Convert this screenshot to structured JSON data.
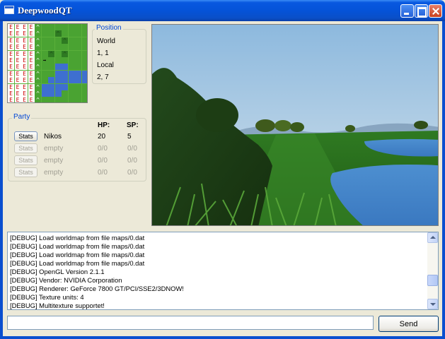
{
  "window": {
    "title": "DeepwoodQT",
    "minimize_label": "",
    "maximize_label": "",
    "close_label": ""
  },
  "minimap": {
    "border_char": "E",
    "mountain_char": "^",
    "player_char": "➡"
  },
  "position": {
    "group_title": "Position",
    "world_label": "World",
    "world_value": "1, 1",
    "local_label": "Local",
    "local_value": "2, 7"
  },
  "party": {
    "group_title": "Party",
    "hp_header": "HP:",
    "sp_header": "SP:",
    "stats_label": "Stats",
    "members": [
      {
        "name": "Nikos",
        "hp": "20",
        "sp": "5",
        "enabled": true
      },
      {
        "name": "empty",
        "hp": "0/0",
        "sp": "0/0",
        "enabled": false
      },
      {
        "name": "empty",
        "hp": "0/0",
        "sp": "0/0",
        "enabled": false
      },
      {
        "name": "empty",
        "hp": "0/0",
        "sp": "0/0",
        "enabled": false
      }
    ]
  },
  "log": {
    "lines": [
      "[DEBUG] Load worldmap from file maps/0.dat",
      "[DEBUG] Load worldmap from file maps/0.dat",
      "[DEBUG] Load worldmap from file maps/0.dat",
      "[DEBUG] Load worldmap from file maps/0.dat",
      "[DEBUG] OpenGL Version 2.1.1",
      "[DEBUG] Vendor: NVIDIA Corporation",
      "[DEBUG] Renderer: GeForce 7800 GT/PCI/SSE2/3DNOW!",
      "[DEBUG] Texture units: 4",
      "[DEBUG] Multitexture supportet!"
    ]
  },
  "command": {
    "input_value": "",
    "send_label": "Send"
  },
  "colors": {
    "titlebar": "#0553d8",
    "window_bg": "#ece9d8",
    "group_title": "#0046d5",
    "grass": "#4aa332",
    "water": "#3e6fd0",
    "sky": "#7fb0d6"
  }
}
